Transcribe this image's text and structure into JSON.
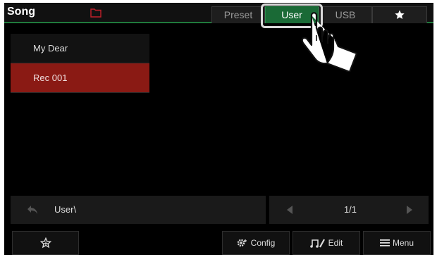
{
  "header": {
    "title": "Song",
    "folder_icon": "folder-icon",
    "tabs": [
      {
        "label": "Preset",
        "active": false
      },
      {
        "label": "User",
        "active": true
      },
      {
        "label": "USB",
        "active": false
      },
      {
        "icon": "star-icon",
        "active": false
      }
    ]
  },
  "song_list": {
    "items": [
      {
        "label": "My Dear",
        "selected": false
      },
      {
        "label": "Rec 001",
        "selected": true
      }
    ]
  },
  "path_bar": {
    "path": "User\\",
    "back_icon": "back-arrow-icon"
  },
  "pager": {
    "page": "1/1"
  },
  "bottom_bar": {
    "favorite_icon": "star-outline-icon",
    "config_label": "Config",
    "edit_label": "Edit",
    "menu_label": "Menu"
  },
  "colors": {
    "accent": "#1f7a3c",
    "active_tab": "#1a6a36",
    "selected_item": "#8a1a14",
    "folder": "#c0202a"
  }
}
